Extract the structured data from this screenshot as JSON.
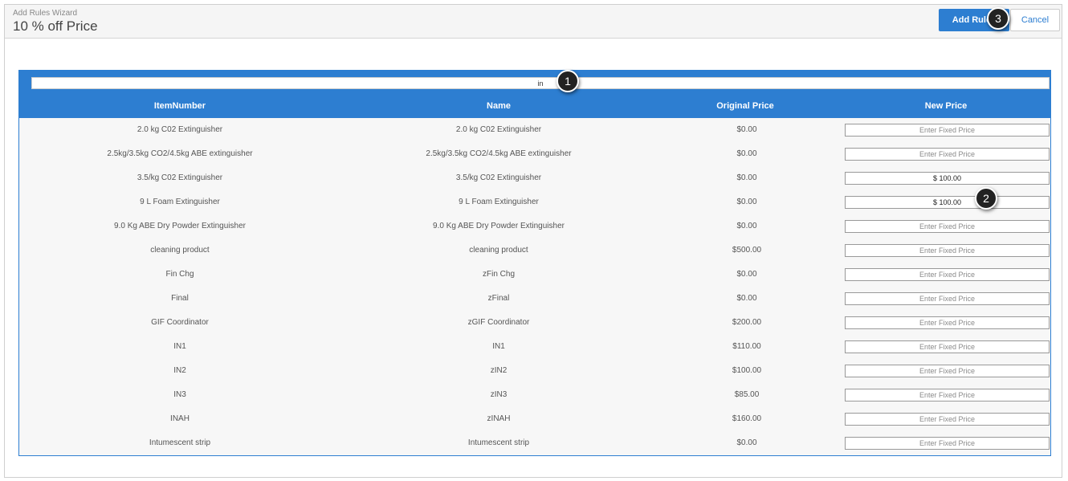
{
  "wizard": {
    "subtitle": "Add Rules Wizard",
    "title": "10 % off Price",
    "add_button": "Add Rules",
    "cancel_button": "Cancel"
  },
  "filter": {
    "value": "in"
  },
  "table": {
    "headers": [
      "ItemNumber",
      "Name",
      "Original Price",
      "New Price"
    ],
    "placeholder": "Enter Fixed Price",
    "rows": [
      {
        "item_number": "2.0 kg C02 Extinguisher",
        "name": "2.0 kg C02 Extinguisher",
        "original_price": "$0.00",
        "new_price": ""
      },
      {
        "item_number": "2.5kg/3.5kg CO2/4.5kg ABE extinguisher",
        "name": "2.5kg/3.5kg CO2/4.5kg ABE extinguisher",
        "original_price": "$0.00",
        "new_price": ""
      },
      {
        "item_number": "3.5/kg C02 Extinguisher",
        "name": "3.5/kg C02 Extinguisher",
        "original_price": "$0.00",
        "new_price": "$ 100.00"
      },
      {
        "item_number": "9 L Foam Extinguisher",
        "name": "9 L Foam Extinguisher",
        "original_price": "$0.00",
        "new_price": "$ 100.00"
      },
      {
        "item_number": "9.0 Kg ABE Dry Powder Extinguisher",
        "name": "9.0 Kg ABE Dry Powder Extinguisher",
        "original_price": "$0.00",
        "new_price": ""
      },
      {
        "item_number": "cleaning product",
        "name": "cleaning product",
        "original_price": "$500.00",
        "new_price": ""
      },
      {
        "item_number": "Fin Chg",
        "name": "zFin Chg",
        "original_price": "$0.00",
        "new_price": ""
      },
      {
        "item_number": "Final",
        "name": "zFinal",
        "original_price": "$0.00",
        "new_price": ""
      },
      {
        "item_number": "GIF Coordinator",
        "name": "zGIF Coordinator",
        "original_price": "$200.00",
        "new_price": ""
      },
      {
        "item_number": "IN1",
        "name": "IN1",
        "original_price": "$110.00",
        "new_price": ""
      },
      {
        "item_number": "IN2",
        "name": "zIN2",
        "original_price": "$100.00",
        "new_price": ""
      },
      {
        "item_number": "IN3",
        "name": "zIN3",
        "original_price": "$85.00",
        "new_price": ""
      },
      {
        "item_number": "INAH",
        "name": "zINAH",
        "original_price": "$160.00",
        "new_price": ""
      },
      {
        "item_number": "Intumescent strip",
        "name": "Intumescent strip",
        "original_price": "$0.00",
        "new_price": ""
      }
    ]
  },
  "callouts": [
    "1",
    "2",
    "3"
  ],
  "colors": {
    "accent": "#2d7ed1",
    "header_bg": "#f5f5f5",
    "table_bg": "#f7f7f7",
    "callout_bg": "#222222"
  }
}
